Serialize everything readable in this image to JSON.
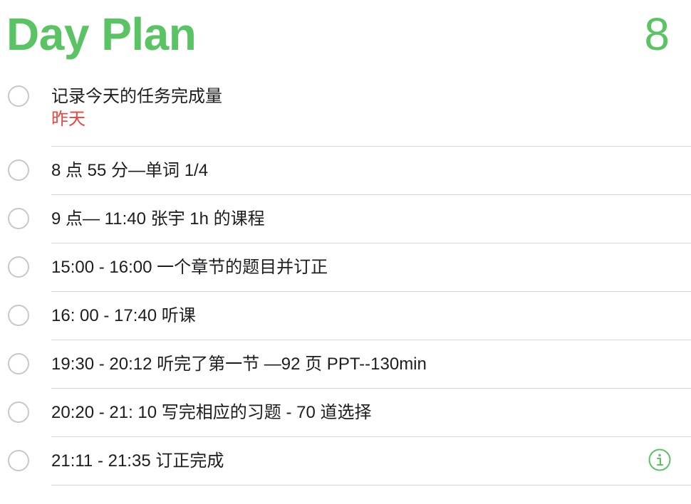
{
  "header": {
    "title": "Day Plan",
    "count": "8"
  },
  "colors": {
    "accent": "#5ac363",
    "danger": "#e8453c",
    "circle_border": "#c7c7cc",
    "divider": "#d8d8dc"
  },
  "items": [
    {
      "text": "记录今天的任务完成量",
      "note": "昨天",
      "completed": false,
      "icon": "info-icon"
    },
    {
      "text": "8 点 55 分—单词 1/4",
      "completed": false
    },
    {
      "text": "9 点—  11:40  张宇 1h 的课程",
      "completed": false
    },
    {
      "text": "15:00 - 16:00 一个章节的题目并订正",
      "completed": false
    },
    {
      "text": "16: 00 - 17:40 听课",
      "completed": false
    },
    {
      "text": "19:30 - 20:12 听完了第一节 —92 页 PPT--130min",
      "completed": false
    },
    {
      "text": "20:20 - 21: 10 写完相应的习题 - 70 道选择",
      "completed": false
    },
    {
      "text": "21:11 - 21:35 订正完成",
      "completed": false,
      "show_info": true
    }
  ]
}
